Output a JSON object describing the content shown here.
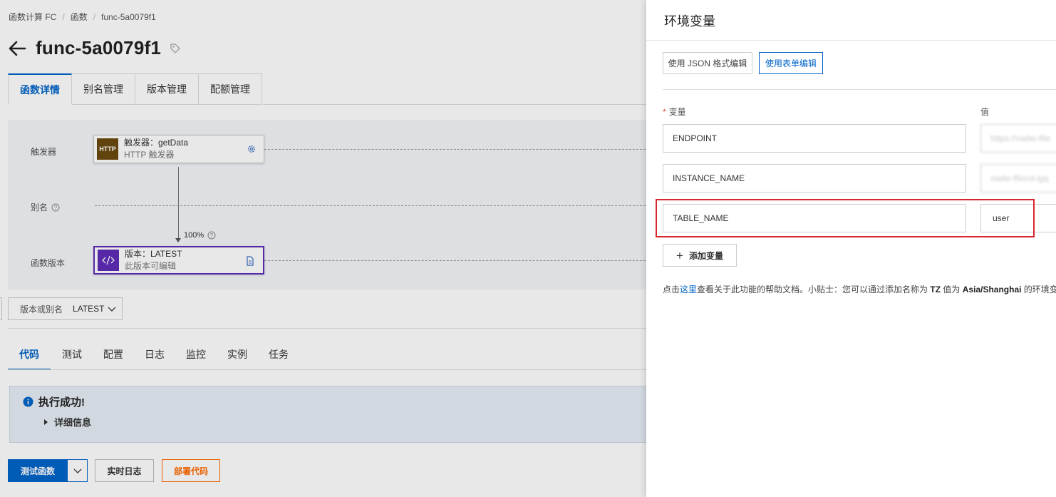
{
  "breadcrumb": [
    "函数计算 FC",
    "函数",
    "func-5a0079f1"
  ],
  "page_title": "func-5a0079f1",
  "top_tabs": [
    {
      "label": "函数详情",
      "active": true
    },
    {
      "label": "别名管理",
      "active": false
    },
    {
      "label": "版本管理",
      "active": false
    },
    {
      "label": "配额管理",
      "active": false
    }
  ],
  "diagram": {
    "row_labels": {
      "trigger": "触发器",
      "alias": "别名",
      "version": "函数版本"
    },
    "trigger_node": {
      "icon_text": "HTTP",
      "title": "触发器：getData",
      "subtitle": "HTTP 触发器"
    },
    "version_node": {
      "title": "版本：LATEST",
      "subtitle": "此版本可编辑"
    },
    "traffic": "100%"
  },
  "version_select": {
    "label": "版本或别名",
    "value": "LATEST"
  },
  "code_tabs": [
    {
      "label": "代码",
      "active": true
    },
    {
      "label": "测试",
      "active": false
    },
    {
      "label": "配置",
      "active": false
    },
    {
      "label": "日志",
      "active": false
    },
    {
      "label": "监控",
      "active": false
    },
    {
      "label": "实例",
      "active": false
    },
    {
      "label": "任务",
      "active": false
    }
  ],
  "result": {
    "title": "执行成功!",
    "details": "详细信息"
  },
  "actions": {
    "test": "测试函数",
    "logs": "实时日志",
    "deploy": "部署代码"
  },
  "drawer": {
    "title": "环境变量",
    "mode_json": "使用 JSON 格式编辑",
    "mode_form": "使用表单编辑",
    "col_key": "变量",
    "col_value": "值",
    "rows": [
      {
        "key": "ENDPOINT",
        "value": "https://vadw-f6e",
        "value_hidden": true
      },
      {
        "key": "INSTANCE_NAME",
        "value": "vadw-f6ecd-igq",
        "value_hidden": true
      },
      {
        "key": "TABLE_NAME",
        "value": "user",
        "value_hidden": false
      }
    ],
    "add_label": "添加变量",
    "help": {
      "prefix": "点击",
      "link": "这里",
      "middle": "查看关于此功能的帮助文档。小贴士：您可以通过添加名称为",
      "tz": "TZ",
      "value_word": "值为",
      "tz_value": "Asia/Shanghai",
      "suffix": "的环境变"
    }
  },
  "colors": {
    "primary": "#0064c8",
    "deploy": "#ff6a00",
    "highlight": "#d9262c",
    "version_node": "#5f2cb8",
    "http_icon": "#6b4a10"
  }
}
